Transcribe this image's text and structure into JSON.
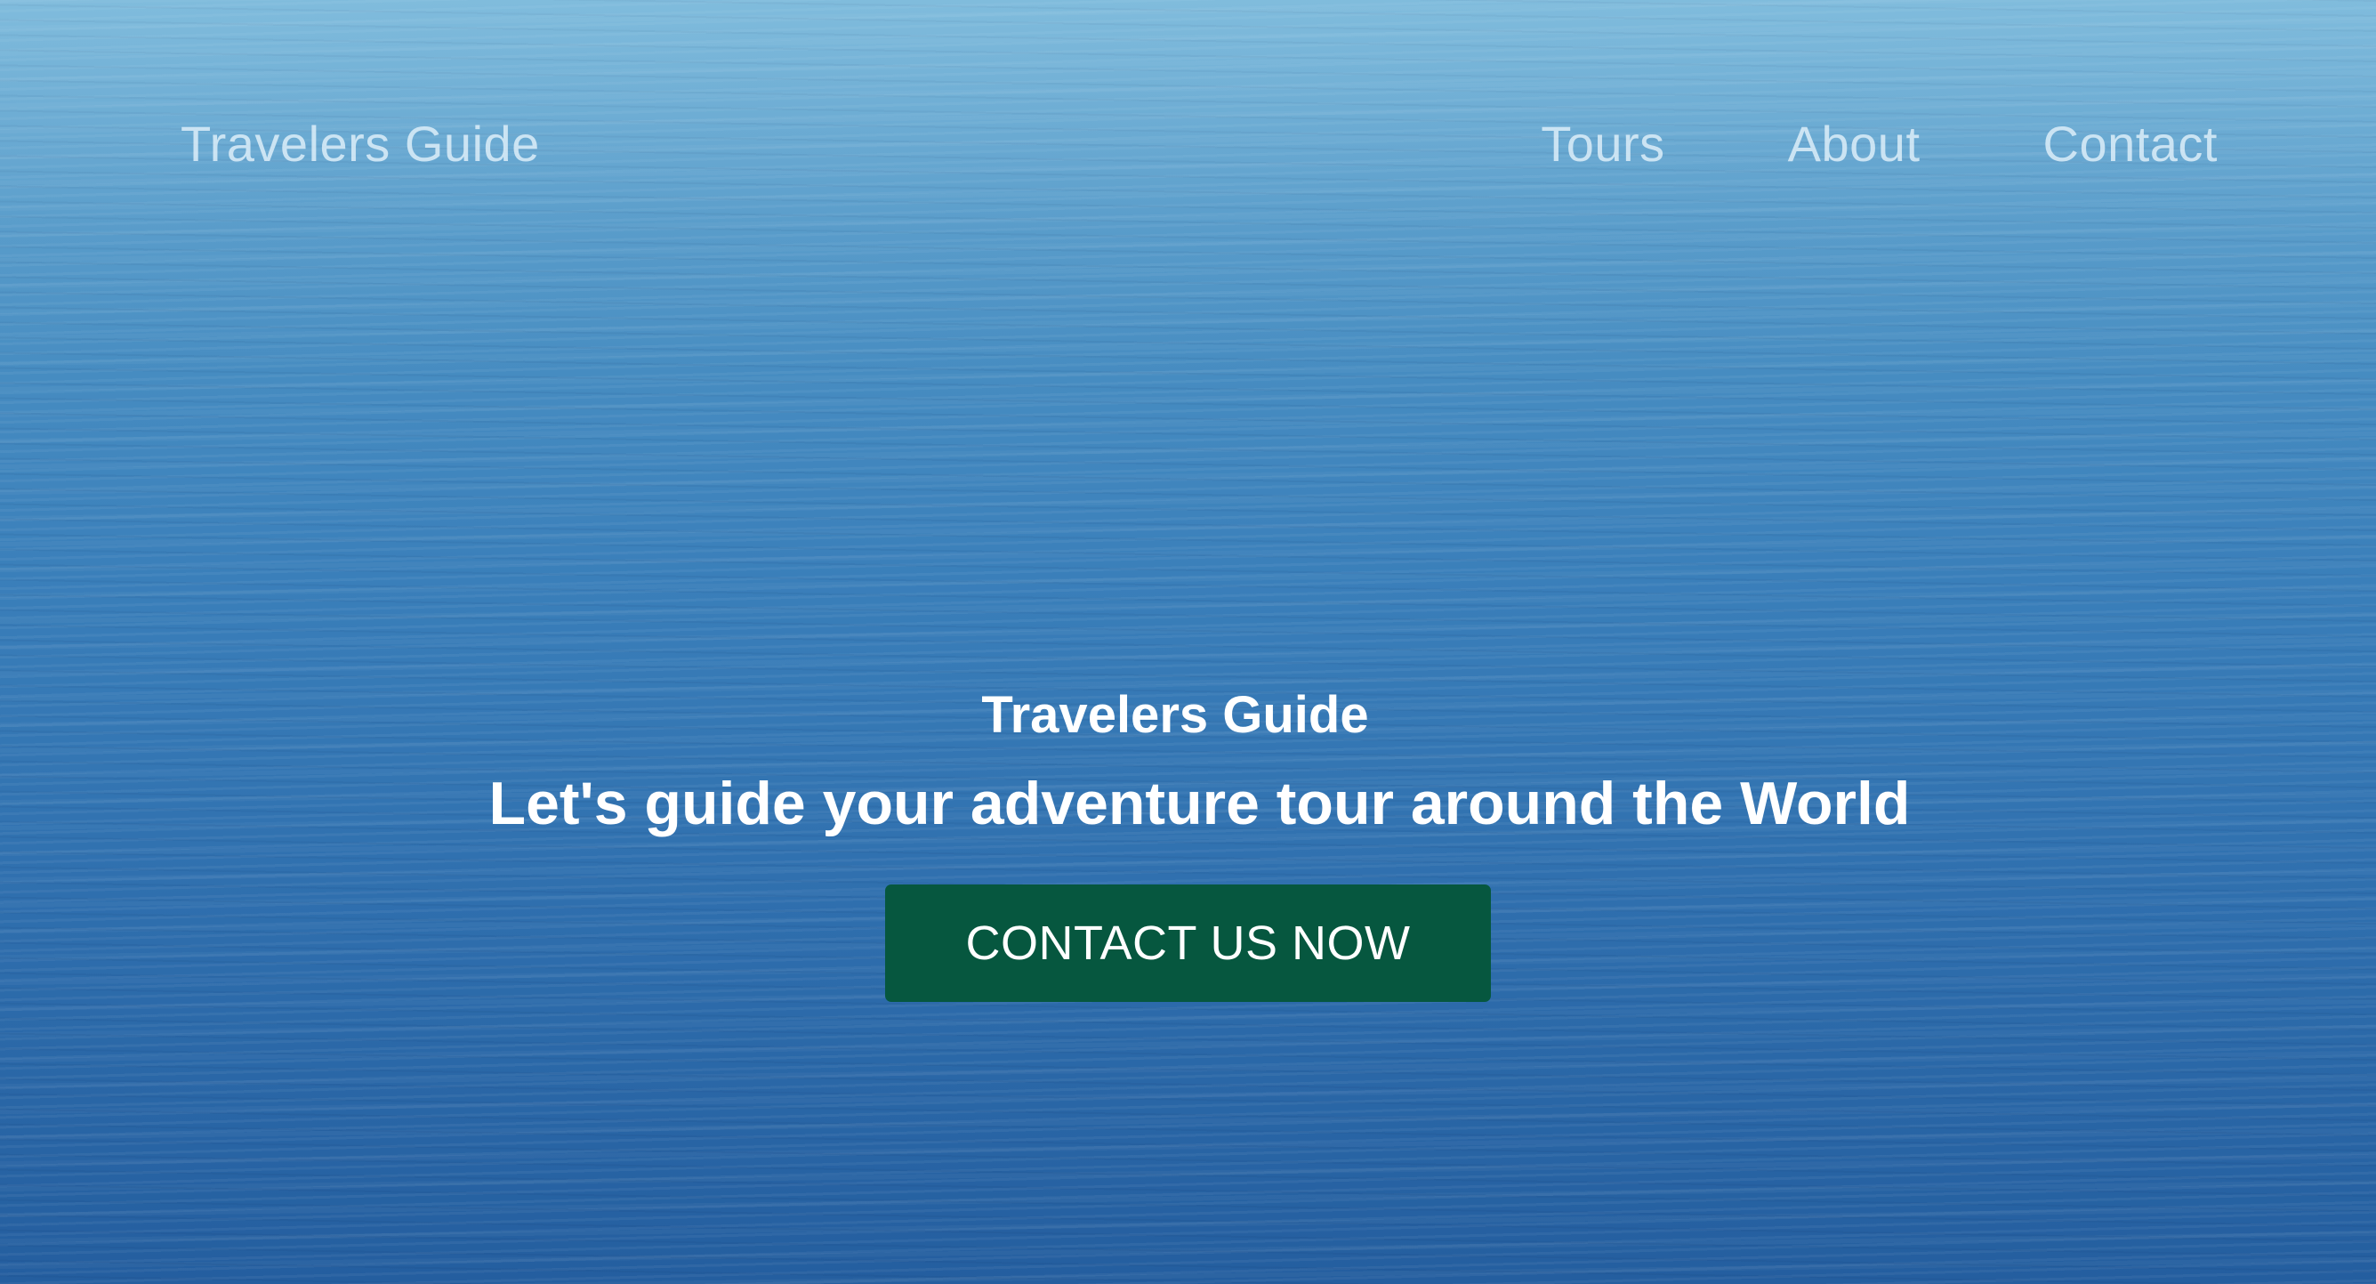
{
  "navbar": {
    "brand": "Travelers Guide",
    "links": [
      {
        "label": "Tours"
      },
      {
        "label": "About"
      },
      {
        "label": "Contact"
      }
    ]
  },
  "hero": {
    "kicker": "Travelers Guide",
    "headline": "Let's guide your adventure tour around the World",
    "cta_label": "CONTACT US NOW"
  },
  "colors": {
    "cta_background": "#06573f",
    "hero_water": "#3a7fba",
    "text": "#ffffff"
  }
}
